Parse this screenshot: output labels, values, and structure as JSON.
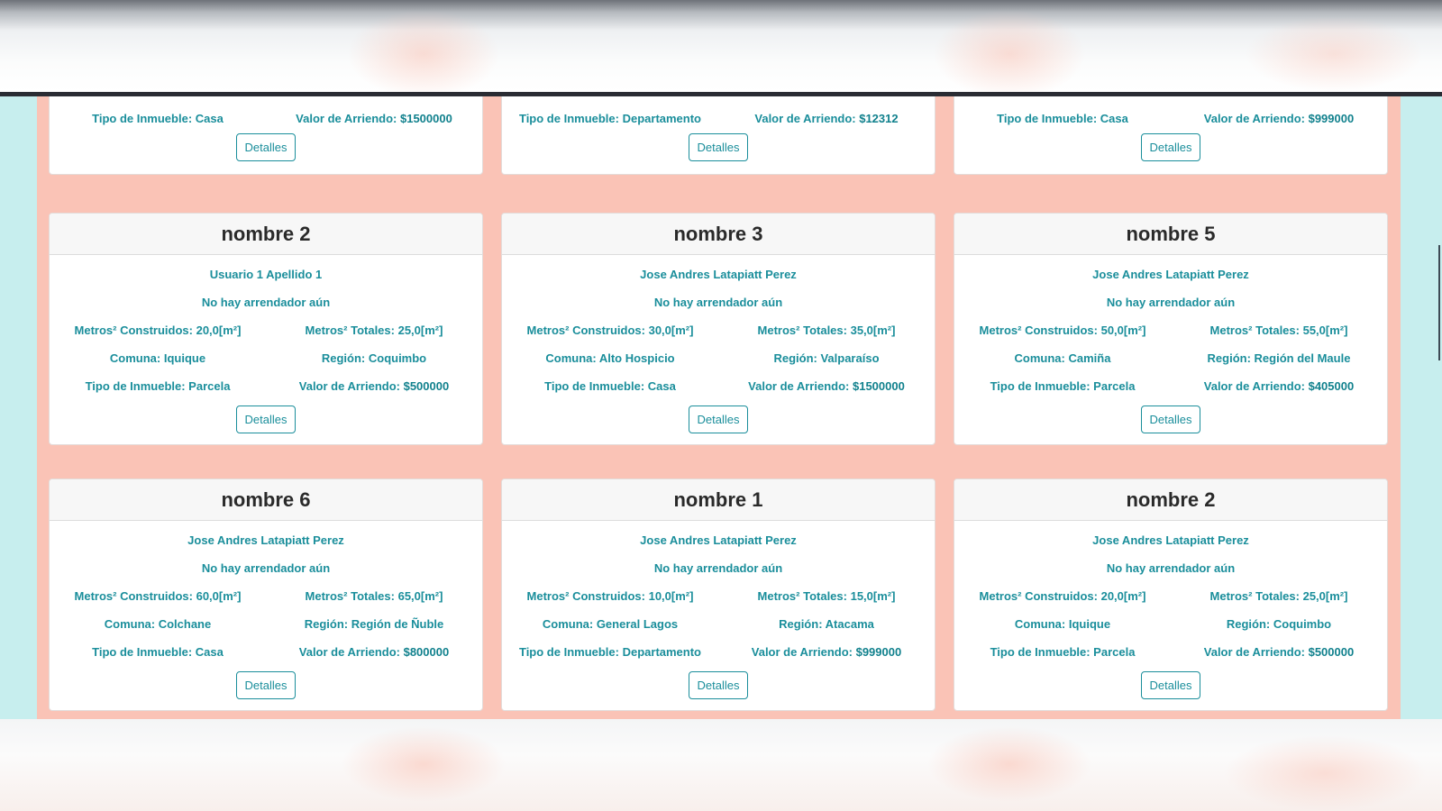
{
  "labels": {
    "detalles": "Detalles",
    "metros_construidos": "Metros² Construidos: ",
    "metros_totales": "Metros² Totales: ",
    "comuna": "Comuna: ",
    "region": "Región: ",
    "tipo": "Tipo de Inmueble: ",
    "valor": "Valor de Arriendo: "
  },
  "partial_row": [
    {
      "tipo": "Casa",
      "valor": "$1500000"
    },
    {
      "tipo": "Departamento",
      "valor": "$12312"
    },
    {
      "tipo": "Casa",
      "valor": "$999000"
    }
  ],
  "cards": [
    {
      "title": "nombre 2",
      "owner": "Usuario 1 Apellido 1",
      "tenant": "No hay arrendador aún",
      "construidos": "20,0[m²]",
      "totales": "25,0[m²]",
      "comuna": "Iquique",
      "region": "Coquimbo",
      "tipo": "Parcela",
      "valor": "$500000"
    },
    {
      "title": "nombre 3",
      "owner": "Jose Andres Latapiatt Perez",
      "tenant": "No hay arrendador aún",
      "construidos": "30,0[m²]",
      "totales": "35,0[m²]",
      "comuna": "Alto Hospicio",
      "region": "Valparaíso",
      "tipo": "Casa",
      "valor": "$1500000"
    },
    {
      "title": "nombre 5",
      "owner": "Jose Andres Latapiatt Perez",
      "tenant": "No hay arrendador aún",
      "construidos": "50,0[m²]",
      "totales": "55,0[m²]",
      "comuna": "Camiña",
      "region": "Región del Maule",
      "tipo": "Parcela",
      "valor": "$405000"
    },
    {
      "title": "nombre 6",
      "owner": "Jose Andres Latapiatt Perez",
      "tenant": "No hay arrendador aún",
      "construidos": "60,0[m²]",
      "totales": "65,0[m²]",
      "comuna": "Colchane",
      "region": "Región de Ñuble",
      "tipo": "Casa",
      "valor": "$800000"
    },
    {
      "title": "nombre 1",
      "owner": "Jose Andres Latapiatt Perez",
      "tenant": "No hay arrendador aún",
      "construidos": "10,0[m²]",
      "totales": "15,0[m²]",
      "comuna": "General Lagos",
      "region": "Atacama",
      "tipo": "Departamento",
      "valor": "$999000"
    },
    {
      "title": "nombre 2",
      "owner": "Jose Andres Latapiatt Perez",
      "tenant": "No hay arrendador aún",
      "construidos": "20,0[m²]",
      "totales": "25,0[m²]",
      "comuna": "Iquique",
      "region": "Coquimbo",
      "tipo": "Parcela",
      "valor": "$500000"
    }
  ],
  "colors": {
    "panel_bg": "#fac3b6",
    "side_bg": "#c7eeee",
    "accent_text": "#1a8e9b",
    "title_text": "#2a2a2a"
  }
}
